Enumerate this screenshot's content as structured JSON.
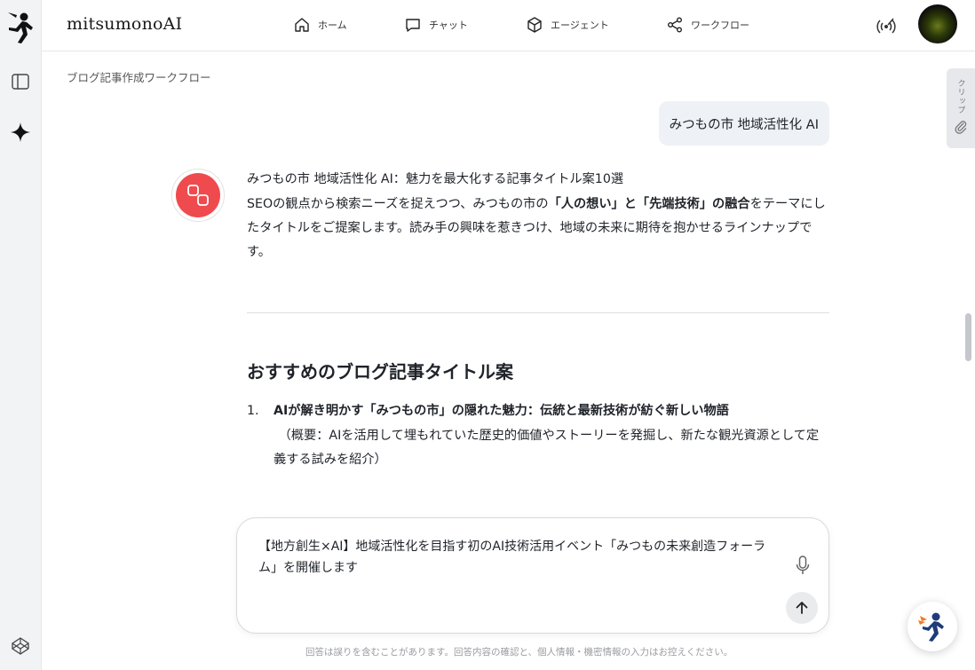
{
  "app": {
    "brand": "mitsumonoAI"
  },
  "nav": {
    "items": [
      {
        "label": "ホーム",
        "icon": "home-icon"
      },
      {
        "label": "チャット",
        "icon": "chat-icon"
      },
      {
        "label": "エージェント",
        "icon": "cube-icon"
      },
      {
        "label": "ワークフロー",
        "icon": "share-icon"
      }
    ]
  },
  "breadcrumb": "ブログ記事作成ワークフロー",
  "clip_tab": {
    "label": "クリップ"
  },
  "user_message": "みつもの市 地域活性化 AI",
  "answer": {
    "title": "みつもの市 地域活性化 AI：魅力を最大化する記事タイトル案10選",
    "intro_before": "SEOの観点から検索ニーズを捉えつつ、みつもの市の",
    "intro_bold": "「人の想い」と「先端技術」の融合",
    "intro_after": "をテーマにしたタイトルをご提案します。読み手の興味を惹きつけ、地域の未来に期待を抱かせるラインナップです。",
    "section_heading": "おすすめのブログ記事タイトル案",
    "list": [
      {
        "num": "1.",
        "title": "AIが解き明かす「みつもの市」の隠れた魅力：伝統と最新技術が紡ぐ新しい物語",
        "desc": "（概要：AIを活用して埋もれていた歴史的価値やストーリーを発掘し、新たな観光資源として定義する試みを紹介）"
      }
    ]
  },
  "composer": {
    "text": "【地方創生×AI】地域活性化を目指す初のAI技術活用イベント「みつもの未来創造フォーラム」を開催します"
  },
  "disclaimer": "回答は誤りを含むことがあります。回答内容の確認と、個人情報・機密情報の入力はお控えください。",
  "colors": {
    "accent_red": "#ef4b4f",
    "rail_bg": "#f2f3f5",
    "bubble_bg": "#eef1f6"
  }
}
